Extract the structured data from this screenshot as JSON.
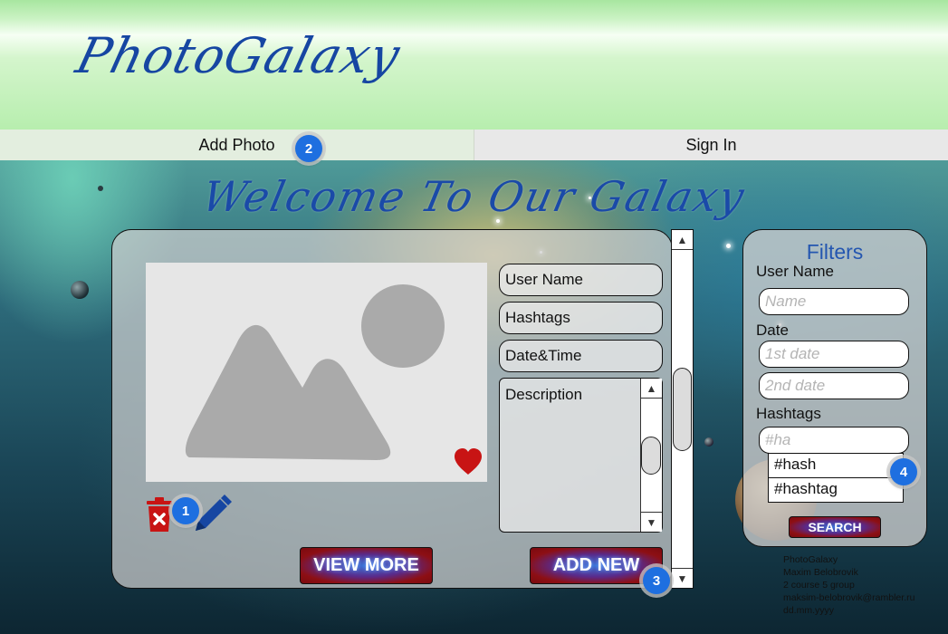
{
  "header": {
    "logo": "PhotoGalaxy"
  },
  "nav": {
    "add_photo": "Add Photo",
    "sign_in": "Sign In"
  },
  "welcome": "Welcome To Our Galaxy",
  "post": {
    "user_name": "User Name",
    "hashtags": "Hashtags",
    "date_time": "Date&Time",
    "description": "Description",
    "view_more_label": "VIEW MORE",
    "add_new_label": "ADD NEW"
  },
  "filters": {
    "title": "Filters",
    "user_name_label": "User Name",
    "name_placeholder": "Name",
    "date_label": "Date",
    "date1_placeholder": "1st date",
    "date2_placeholder": "2nd date",
    "hashtags_label": "Hashtags",
    "hashtag_placeholder": "#ha",
    "suggestions": [
      "#hash",
      "#hashtag"
    ],
    "search_label": "SEARCH"
  },
  "footer": {
    "lines": [
      "PhotoGalaxy",
      "Maxim Belobrovik",
      "2 course 5 group",
      "maksim-belobrovik@rambler.ru",
      "dd.mm.yyyy"
    ]
  },
  "badges": [
    "1",
    "2",
    "3",
    "4"
  ],
  "icons": {
    "heart": "heart-icon",
    "trash": "trash-icon",
    "edit": "edit-icon",
    "image": "image-placeholder-icon"
  },
  "colors": {
    "brand_blue": "#1646a2",
    "heart_red": "#c81414",
    "badge_blue": "#1e6fe0"
  }
}
